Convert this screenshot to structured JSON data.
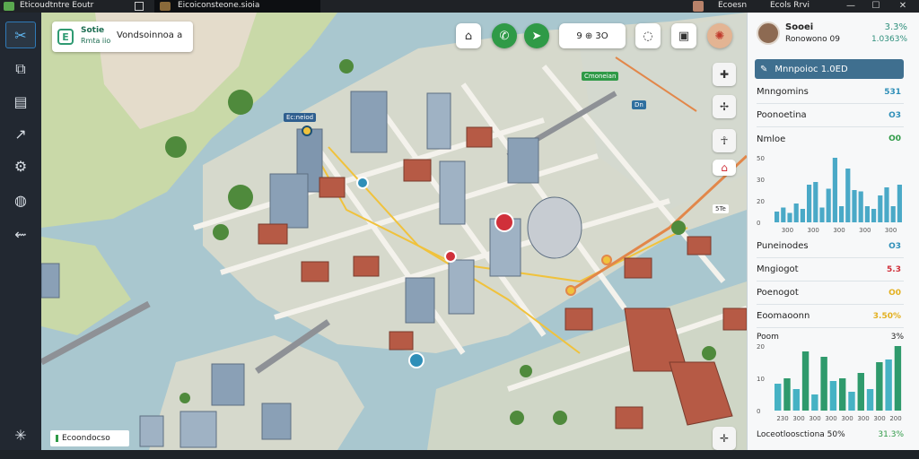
{
  "titlebar": {
    "app_title": "Eticoudtntre Eoutr",
    "tab_title": "Eicoiconsteone.sioia",
    "items": [
      "Ecoesn",
      "Ecols Rrvi"
    ],
    "controls": [
      "—",
      "☐",
      "✕"
    ]
  },
  "sidebar": {
    "icons": [
      "routes-icon",
      "layers-icon",
      "grid-icon",
      "network-icon",
      "settings-icon",
      "globe-icon",
      "share-icon",
      "flow-icon"
    ]
  },
  "map": {
    "brand": {
      "line1": "Sotie",
      "line2": "Rmta iio",
      "name": "Vondsoinnoa a"
    },
    "legend_chip": "9 ⊕ 3O",
    "footer_label": "Ecoondocso",
    "tags": [
      "Ec:neiod",
      "Cmoneian",
      "Dn",
      "5Te"
    ],
    "colors": {
      "water": "#a9c7cf",
      "land": "#c9d9a8",
      "road": "#f4f2ec",
      "route": "#f0c23c",
      "route_alt": "#e2874a"
    }
  },
  "panel": {
    "user": {
      "name": "Sooei",
      "sub": "Ronowono 09",
      "stat1": "3.3%",
      "stat2": "1.0363%"
    },
    "search": "Mnnpoioc 1.0ED",
    "metrics": [
      {
        "label": "Mnngomins",
        "value": "531",
        "color": "#2f8fb8"
      },
      {
        "label": "Poonoetina",
        "value": "O3",
        "color": "#2f8fb8"
      },
      {
        "label": "Nmloe",
        "value": "O0",
        "color": "#2f9a47"
      },
      {
        "label": "Puneinodes",
        "value": "O3",
        "color": "#2f8fb8"
      },
      {
        "label": "Mngiogot",
        "value": "5.3",
        "color": "#d0303a"
      },
      {
        "label": "Poenogot",
        "value": "O0",
        "color": "#e3b020"
      },
      {
        "label": "Eoomaoonn",
        "value": "3.50%",
        "color": "#e3b020"
      }
    ],
    "footer_left": "Loceotloosctiona 50%",
    "footer_right": "31.3%"
  },
  "chart_data": [
    {
      "type": "bar",
      "y_ticks": [
        "50",
        "30",
        "20",
        "0"
      ],
      "x_labels": [
        "300",
        "300",
        "300",
        "300",
        "300"
      ],
      "values": [
        8,
        11,
        7,
        14,
        10,
        28,
        30,
        11,
        25,
        48,
        12,
        40,
        24,
        23,
        12,
        10,
        20,
        26,
        12,
        28
      ],
      "color": "#4aa9c7"
    },
    {
      "type": "bar",
      "title": "Poom",
      "percent": "3%",
      "y_ticks": [
        "20",
        "10",
        "0"
      ],
      "x_labels": [
        "230",
        "300",
        "300",
        "300",
        "300",
        "300",
        "300",
        "200"
      ],
      "values": [
        10,
        12,
        8,
        22,
        6,
        20,
        11,
        12,
        7,
        14,
        8,
        18,
        19,
        24
      ],
      "colors": [
        "#46b2c4",
        "#2f9a6c"
      ]
    }
  ]
}
